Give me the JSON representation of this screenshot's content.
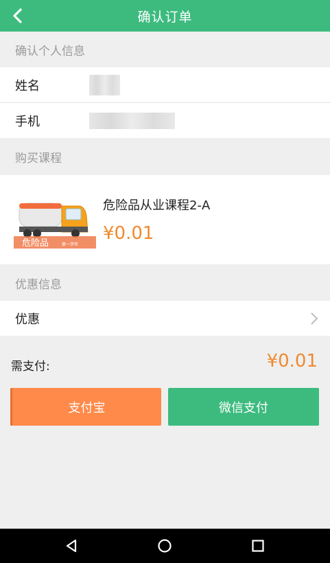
{
  "colors": {
    "accent": "#3dbb7f",
    "price": "#ef8a2e",
    "alipay": "#ff8a4a",
    "wechat": "#3dbb7f"
  },
  "header": {
    "title": "确认订单",
    "back_icon": "chevron-left-icon"
  },
  "personal_info": {
    "section_title": "确认个人信息",
    "name_label": "姓名",
    "phone_label": "手机"
  },
  "course": {
    "section_title": "购买课程",
    "name": "危险品从业课程2-A",
    "price": "¥0.01",
    "thumb_caption": "危险品",
    "thumb_sub": "第一学年",
    "thumb_icon": "fuel-truck-icon"
  },
  "discount": {
    "section_title": "优惠信息",
    "label": "优惠",
    "arrow_icon": "chevron-right-icon"
  },
  "total": {
    "label": "需支付:",
    "value": "¥0.01"
  },
  "payment": {
    "alipay_label": "支付宝",
    "wechat_label": "微信支付"
  },
  "navbar": {
    "back_icon": "triangle-back-icon",
    "home_icon": "circle-home-icon",
    "recents_icon": "square-recents-icon"
  }
}
